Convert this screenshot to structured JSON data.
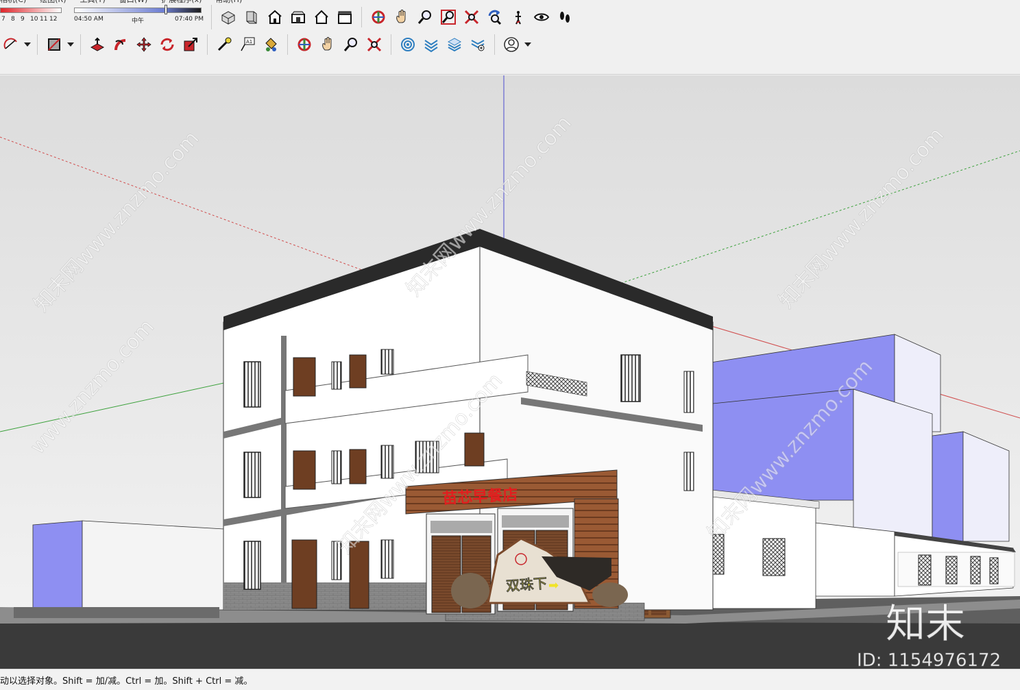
{
  "menubar": {
    "items": [
      "相机(C)",
      "绘图(R)",
      "工具(T)",
      "窗口(W)",
      "扩展程序(x)",
      "帮助(H)"
    ]
  },
  "shadow": {
    "month_ticks": [
      "7",
      "8",
      "9",
      "10",
      "11",
      "12"
    ],
    "time_start": "04:50 AM",
    "time_mid": "中午",
    "time_end": "07:40 PM"
  },
  "toolbar": {
    "row1": [
      "iso-view",
      "top-view",
      "front-view",
      "right-view",
      "back-view",
      "left-view",
      "orbit",
      "pan",
      "zoom",
      "zoom-window",
      "zoom-extents",
      "previous-view",
      "position-camera",
      "look-around",
      "walk"
    ],
    "row2": [
      "arc",
      "rectangle",
      "push-pull",
      "follow-me",
      "move",
      "rotate",
      "scale",
      "tape-measure",
      "text",
      "paint-bucket",
      "orbit",
      "pan",
      "zoom",
      "zoom-extents",
      "section-plane",
      "section-display",
      "layers",
      "outliner",
      "user-account"
    ]
  },
  "scene": {
    "shop_sign": "苗芯早餐店",
    "rock_sign": "双珠下",
    "rock_arrow": "➡",
    "watermark_text": "知末网www.znzmo.com",
    "watermark_alt": "www.znzmo.com"
  },
  "colors": {
    "sky_top": "#dcdcdc",
    "sky_bottom": "#f4f4f4",
    "ground": "#5f5f5f",
    "road": "#3a3a3a",
    "block_fill": "#8e8ff2",
    "shop_sign_red": "#e21e1e",
    "rock_sign_yellow": "#f1e327"
  },
  "status": {
    "message": "动以选择对象。Shift = 加/减。Ctrl = 加。Shift + Ctrl = 减。"
  },
  "brand": {
    "logo": "知末",
    "id_label": "ID: 1154976172"
  }
}
